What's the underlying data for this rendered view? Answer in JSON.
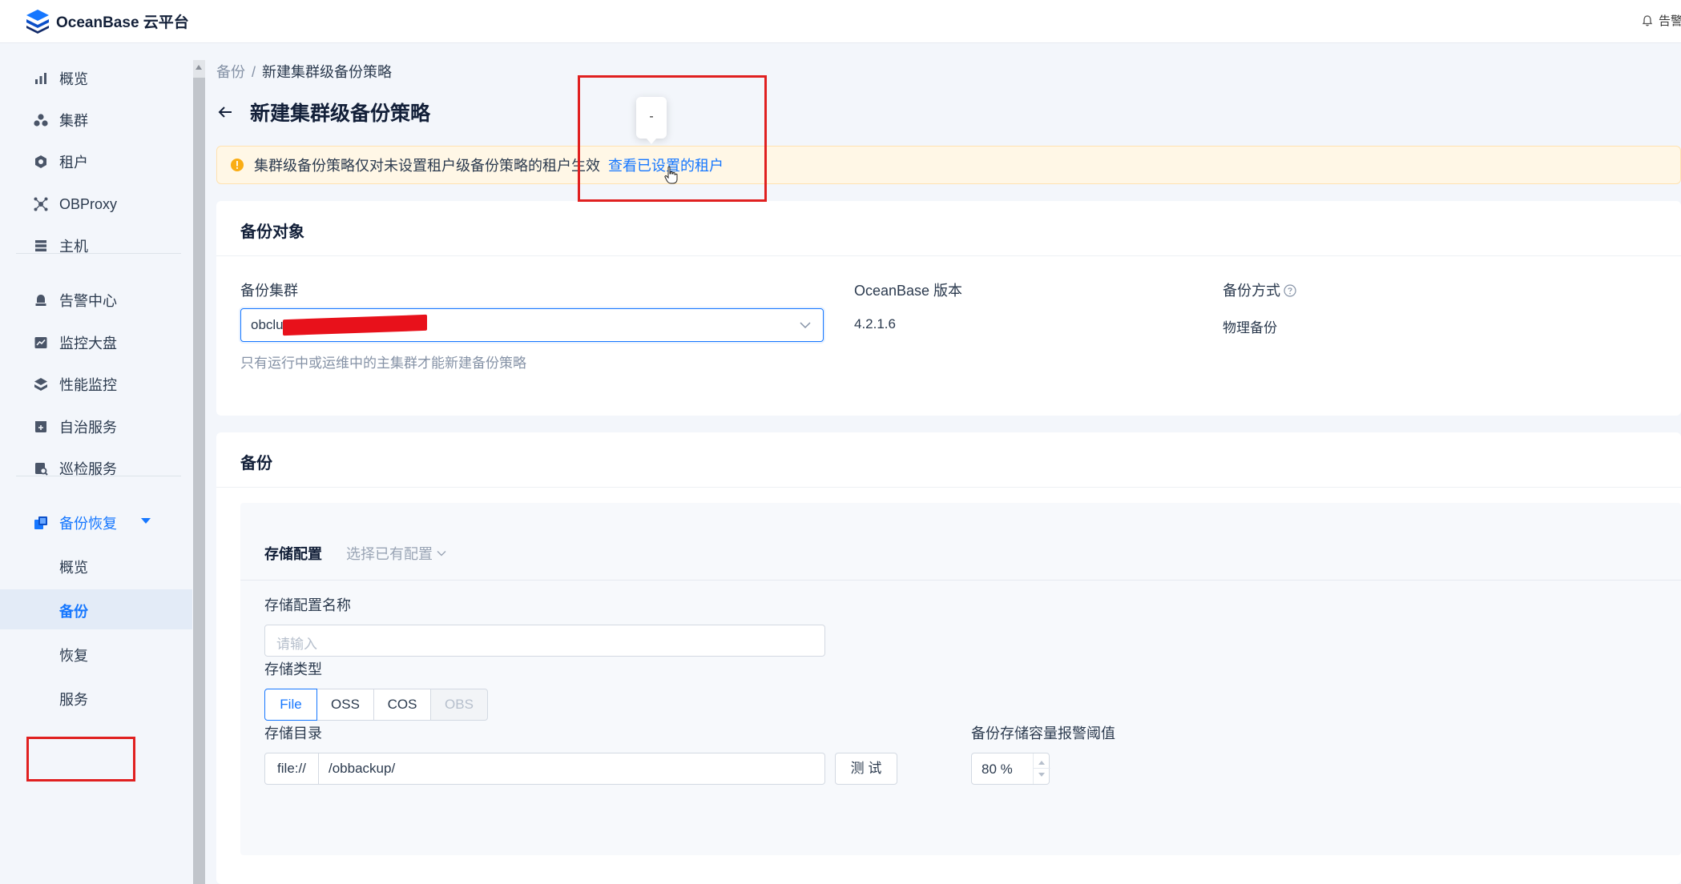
{
  "header": {
    "brand": "OceanBase 云平台",
    "alarm_label": "告警"
  },
  "sidebar": {
    "items": [
      {
        "label": "概览",
        "icon": "bar-chart-icon"
      },
      {
        "label": "集群",
        "icon": "cluster-icon"
      },
      {
        "label": "租户",
        "icon": "tenant-icon"
      },
      {
        "label": "OBProxy",
        "icon": "proxy-icon"
      },
      {
        "label": "主机",
        "icon": "host-icon"
      },
      {
        "label": "告警中心",
        "icon": "alarm-icon"
      },
      {
        "label": "监控大盘",
        "icon": "monitor-icon"
      },
      {
        "label": "性能监控",
        "icon": "performance-icon"
      },
      {
        "label": "自治服务",
        "icon": "autonomy-icon"
      },
      {
        "label": "巡检服务",
        "icon": "inspection-icon"
      }
    ],
    "backup_group": {
      "label": "备份恢复",
      "icon": "backup-restore-icon",
      "children": [
        "概览",
        "备份",
        "恢复",
        "服务"
      ],
      "active_child": "备份"
    }
  },
  "breadcrumb": {
    "parent": "备份",
    "separator": "/",
    "current": "新建集群级备份策略"
  },
  "page": {
    "title": "新建集群级备份策略",
    "tooltip_text": "-"
  },
  "alert": {
    "message": "集群级备份策略仅对未设置租户级备份策略的租户生效",
    "link": "查看已设置的租户"
  },
  "backup_object": {
    "title": "备份对象",
    "cluster_label": "备份集群",
    "cluster_value": "obclu",
    "cluster_hint": "只有运行中或运维中的主集群才能新建备份策略",
    "version_label": "OceanBase 版本",
    "version_value": "4.2.1.6",
    "method_label": "备份方式",
    "method_value": "物理备份"
  },
  "backup": {
    "title": "备份",
    "storage_tab": "存储配置",
    "choose_existing": "选择已有配置",
    "config_name_label": "存储配置名称",
    "config_name_placeholder": "请输入",
    "storage_type_label": "存储类型",
    "storage_types": [
      "File",
      "OSS",
      "COS",
      "OBS"
    ],
    "storage_type_selected": "File",
    "storage_type_disabled": "OBS",
    "dir_label": "存储目录",
    "dir_prefix": "file://",
    "dir_value": "/obbackup/",
    "test_button": "测 试",
    "threshold_label": "备份存储容量报警阈值",
    "threshold_value": "80 %"
  },
  "colors": {
    "primary": "#1677ff",
    "warning_bg": "#fff7e6",
    "warning_icon": "#faad14",
    "highlight_box": "#e02020"
  }
}
